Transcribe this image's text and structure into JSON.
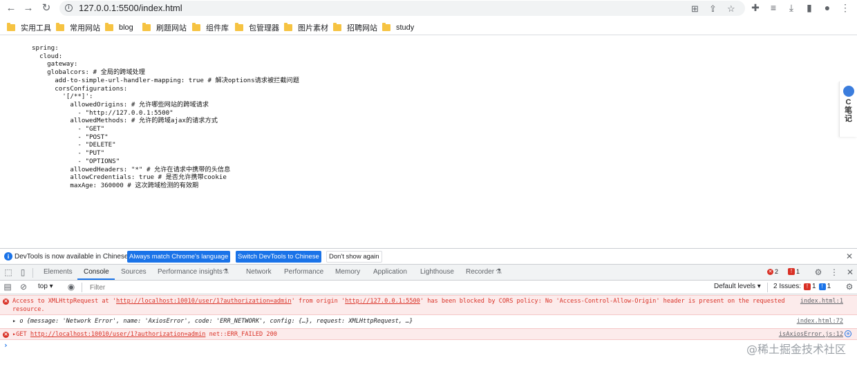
{
  "browser": {
    "url": "127.0.0.1:5500/index.html",
    "bookmarks": [
      "实用工具",
      "常用网站",
      "blog",
      "刷题网站",
      "组件库",
      "包管理器",
      "图片素材",
      "招聘网站",
      "study"
    ]
  },
  "page": {
    "code_lines": [
      "spring:",
      "  cloud:",
      "    gateway:",
      "    globalcors: # 全局的跨域处理",
      "      add-to-simple-url-handler-mapping: true # 解决options请求被拦截问题",
      "      corsConfigurations:",
      "        '[/**]':",
      "          allowedOrigins: # 允许哪些网站的跨域请求",
      "            - \"http://127.0.0.1:5500\"",
      "          allowedMethods: # 允许的跨域ajax的请求方式",
      "            - \"GET\"",
      "            - \"POST\"",
      "            - \"DELETE\"",
      "            - \"PUT\"",
      "            - \"OPTIONS\"",
      "          allowedHeaders: \"*\" # 允许在请求中携带的头信息",
      "          allowCredentials: true # 是否允许携带cookie",
      "          maxAge: 360000 # 这次跨域检测的有效期"
    ],
    "side_widget_text": "C笔记"
  },
  "infobar": {
    "message": "DevTools is now available in Chinese!",
    "btn_match": "Always match Chrome's language",
    "btn_switch": "Switch DevTools to Chinese",
    "btn_dismiss": "Don't show again"
  },
  "devtools": {
    "tabs": [
      "Elements",
      "Console",
      "Sources",
      "Performance insights",
      "Network",
      "Performance",
      "Memory",
      "Application",
      "Lighthouse",
      "Recorder"
    ],
    "active_tab": "Console",
    "error_count": "2",
    "warning_count": "1",
    "context": "top",
    "filter_placeholder": "Filter",
    "levels_label": "Default levels",
    "issues_label": "2 Issues:",
    "issues_red": "1",
    "issues_blue": "1"
  },
  "console": {
    "row1_pre": "Access to XMLHttpRequest at '",
    "row1_url1": "http://localhost:10010/user/1?authorization=admin",
    "row1_mid": "' from origin '",
    "row1_url2": "http://127.0.0.1:5500",
    "row1_post": "' has been blocked by CORS policy: No 'Access-Control-Allow-Origin' header is present on the requested resource.",
    "row1_src": "index.html:1",
    "row2_text": "{message: 'Network Error', name: 'AxiosError', code: 'ERR_NETWORK', config: {…}, request: XMLHttpRequest, …}",
    "row2_src": "index.html:72",
    "row3_method": "GET",
    "row3_url": "http://localhost:10010/user/1?authorization=admin",
    "row3_status": "net::ERR_FAILED 200",
    "row3_src": "isAxiosError.js:12"
  },
  "watermark": "@稀土掘金技术社区"
}
